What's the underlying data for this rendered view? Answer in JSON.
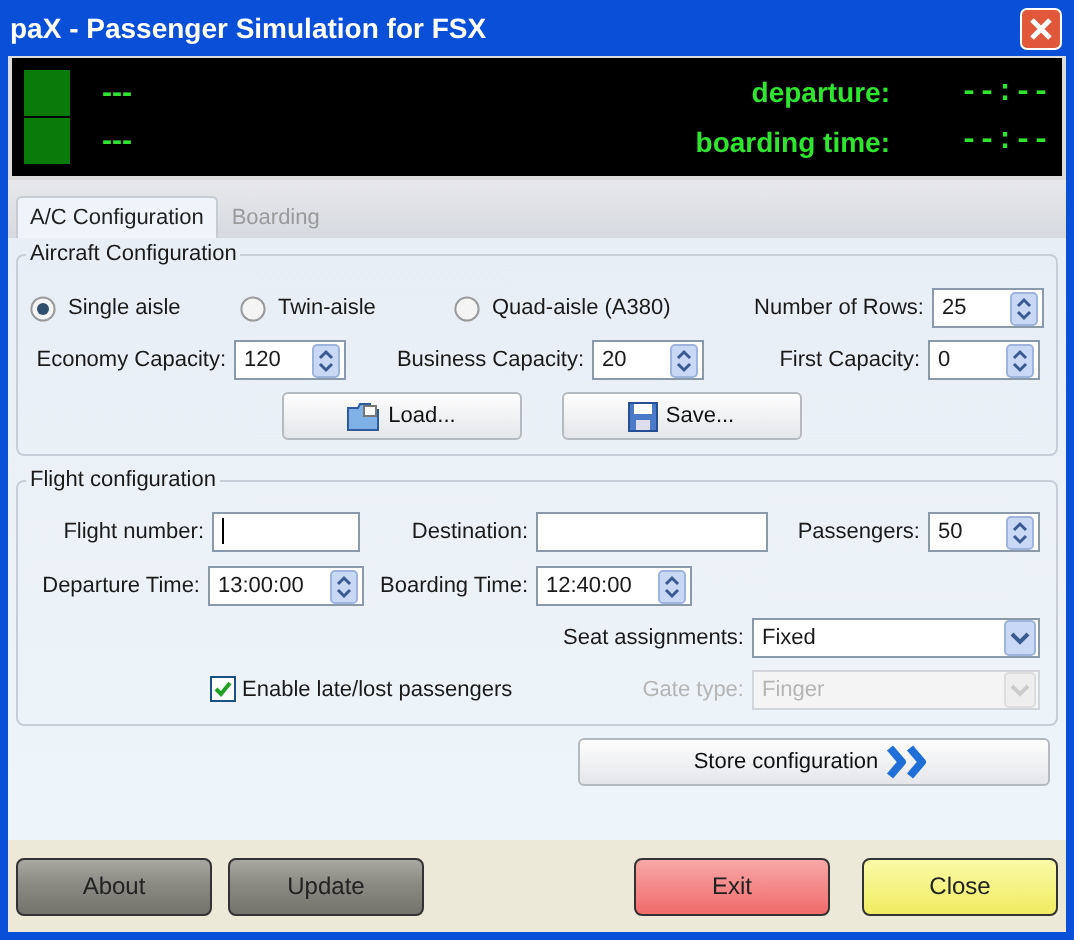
{
  "window": {
    "title": "paX - Passenger Simulation for FSX"
  },
  "display": {
    "rows": [
      {
        "text": "---",
        "label": "departure:",
        "time": "--:--"
      },
      {
        "text": "---",
        "label": "boarding time:",
        "time": "--:--"
      }
    ]
  },
  "tabs": [
    {
      "label": "A/C Configuration",
      "selected": true
    },
    {
      "label": "Boarding",
      "selected": false
    }
  ],
  "aircraft_configuration": {
    "title": "Aircraft Configuration",
    "aisle_options": [
      {
        "label": "Single aisle",
        "selected": true
      },
      {
        "label": "Twin-aisle",
        "selected": false
      },
      {
        "label": "Quad-aisle (A380)",
        "selected": false
      }
    ],
    "number_of_rows": {
      "label": "Number of Rows:",
      "value": "25"
    },
    "capacities": [
      {
        "label": "Economy Capacity:",
        "value": "120"
      },
      {
        "label": "Business Capacity:",
        "value": "20"
      },
      {
        "label": "First Capacity:",
        "value": "0"
      }
    ],
    "buttons": [
      {
        "label": "Load...",
        "kind": "load"
      },
      {
        "label": "Save...",
        "kind": "save"
      }
    ]
  },
  "flight_configuration": {
    "title": "Flight configuration",
    "flight_number": {
      "label": "Flight number:"
    },
    "destination": {
      "label": "Destination:"
    },
    "passengers": {
      "label": "Passengers:",
      "value": "50"
    },
    "departure_time": {
      "label": "Departure Time:",
      "value": "13:00:00"
    },
    "boarding_time": {
      "label": "Boarding Time:",
      "value": "12:40:00"
    },
    "seat_assignments": {
      "label": "Seat assignments:",
      "value": "Fixed",
      "disabled": false
    },
    "late_passengers": {
      "label": "Enable late/lost passengers",
      "checked": true
    },
    "gate_type": {
      "label": "Gate type:",
      "value": "Finger",
      "disabled": true
    }
  },
  "store_button": {
    "label": "Store configuration"
  },
  "bottom_buttons": [
    {
      "label": "About",
      "kind": "grey"
    },
    {
      "label": "Update",
      "kind": "grey"
    },
    {
      "label": "Exit",
      "kind": "red"
    },
    {
      "label": "Close",
      "kind": "yellow"
    }
  ]
}
